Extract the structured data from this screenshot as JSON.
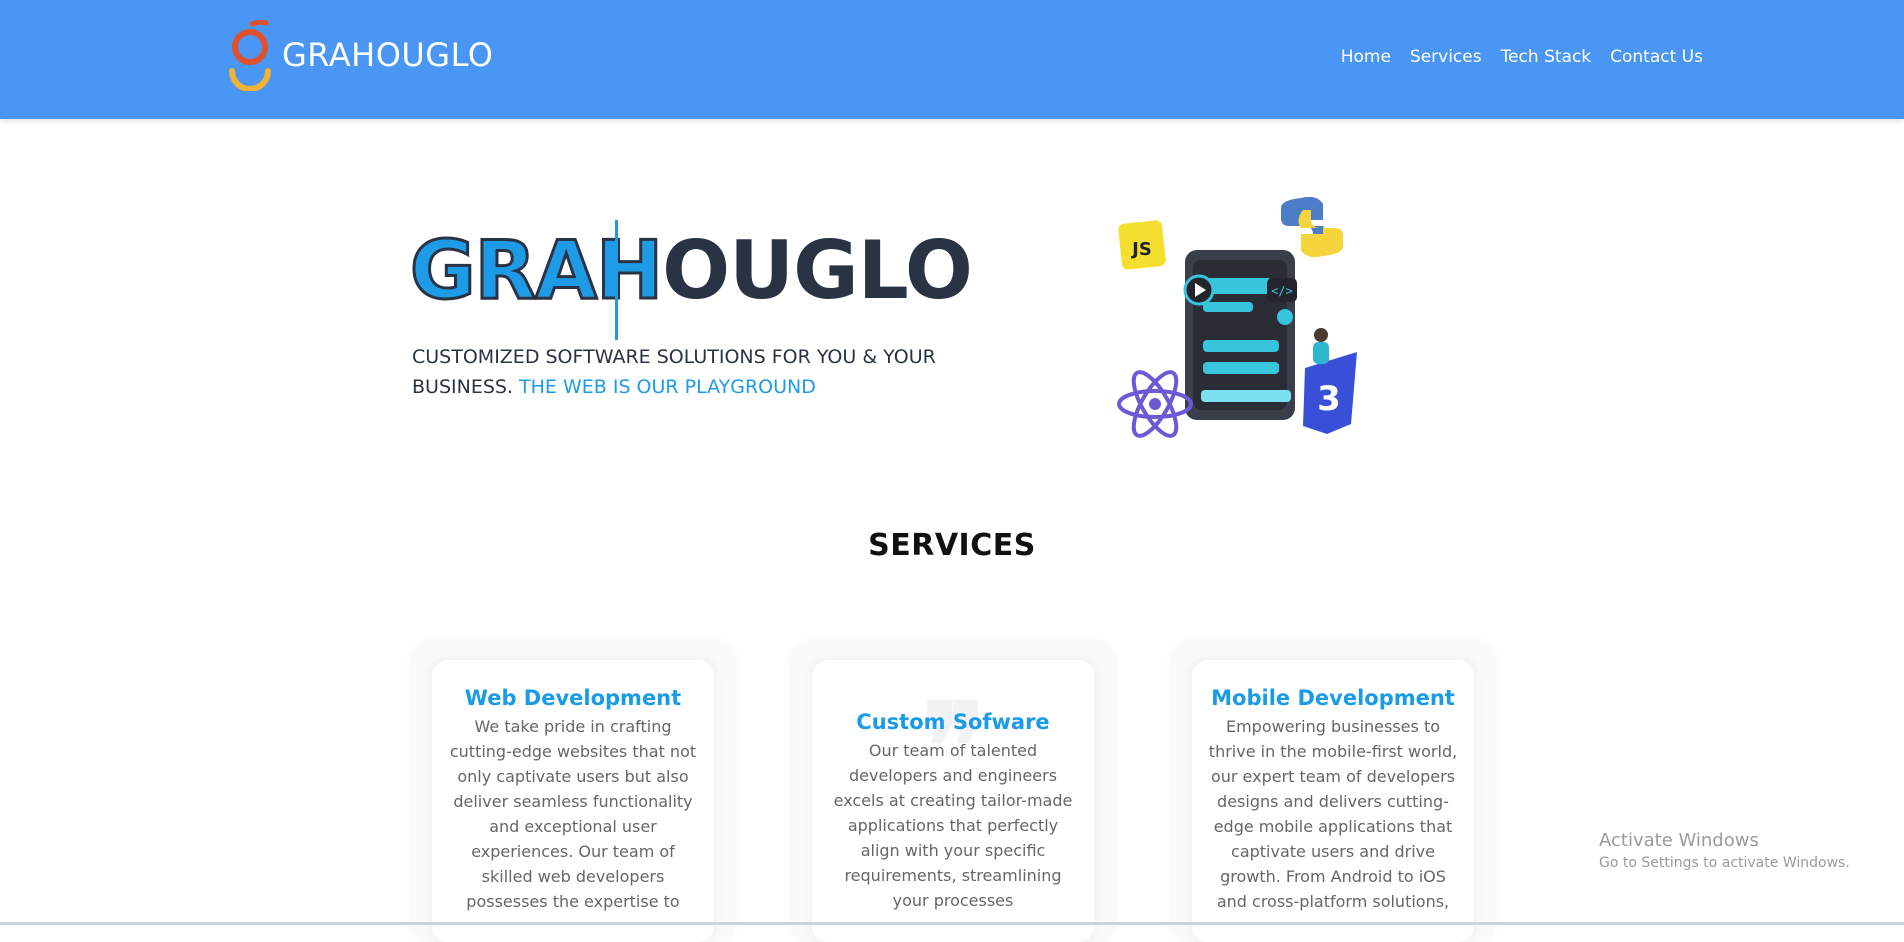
{
  "header": {
    "brand_name": "GRAHOUGLO",
    "nav": [
      "Home",
      "Services",
      "Tech Stack",
      "Contact Us"
    ]
  },
  "hero": {
    "title_part1": "GRAH",
    "title_part2": "OUGLO",
    "subtitle": "CUSTOMIZED SOFTWARE SOLUTIONS FOR YOU & YOUR BUSINESS.",
    "subtitle_highlight": "THE WEB IS OUR PLAYGROUND",
    "illustration_badge": "JS"
  },
  "services": {
    "title": "SERVICES",
    "cards": [
      {
        "title": "Web Development",
        "text": "We take pride in crafting cutting-edge websites that not only captivate users but also deliver seamless functionality and exceptional user experiences. Our team of skilled web developers possesses the expertise to"
      },
      {
        "title": "Custom Sofware",
        "text": "Our team of talented developers and engineers excels at creating tailor-made applications that perfectly align with your specific requirements, streamlining your processes"
      },
      {
        "title": "Mobile Development",
        "text": "Empowering businesses to thrive in the mobile-first world, our expert team of developers designs and delivers cutting-edge mobile applications that captivate users and drive growth. From Android to iOS and cross-platform solutions,"
      }
    ]
  },
  "watermark": {
    "line1": "Activate Windows",
    "line2": "Go to Settings to activate Windows."
  },
  "colors": {
    "header_bg": "#4a96f4",
    "accent": "#1e9be6",
    "dark": "#2a3344"
  }
}
